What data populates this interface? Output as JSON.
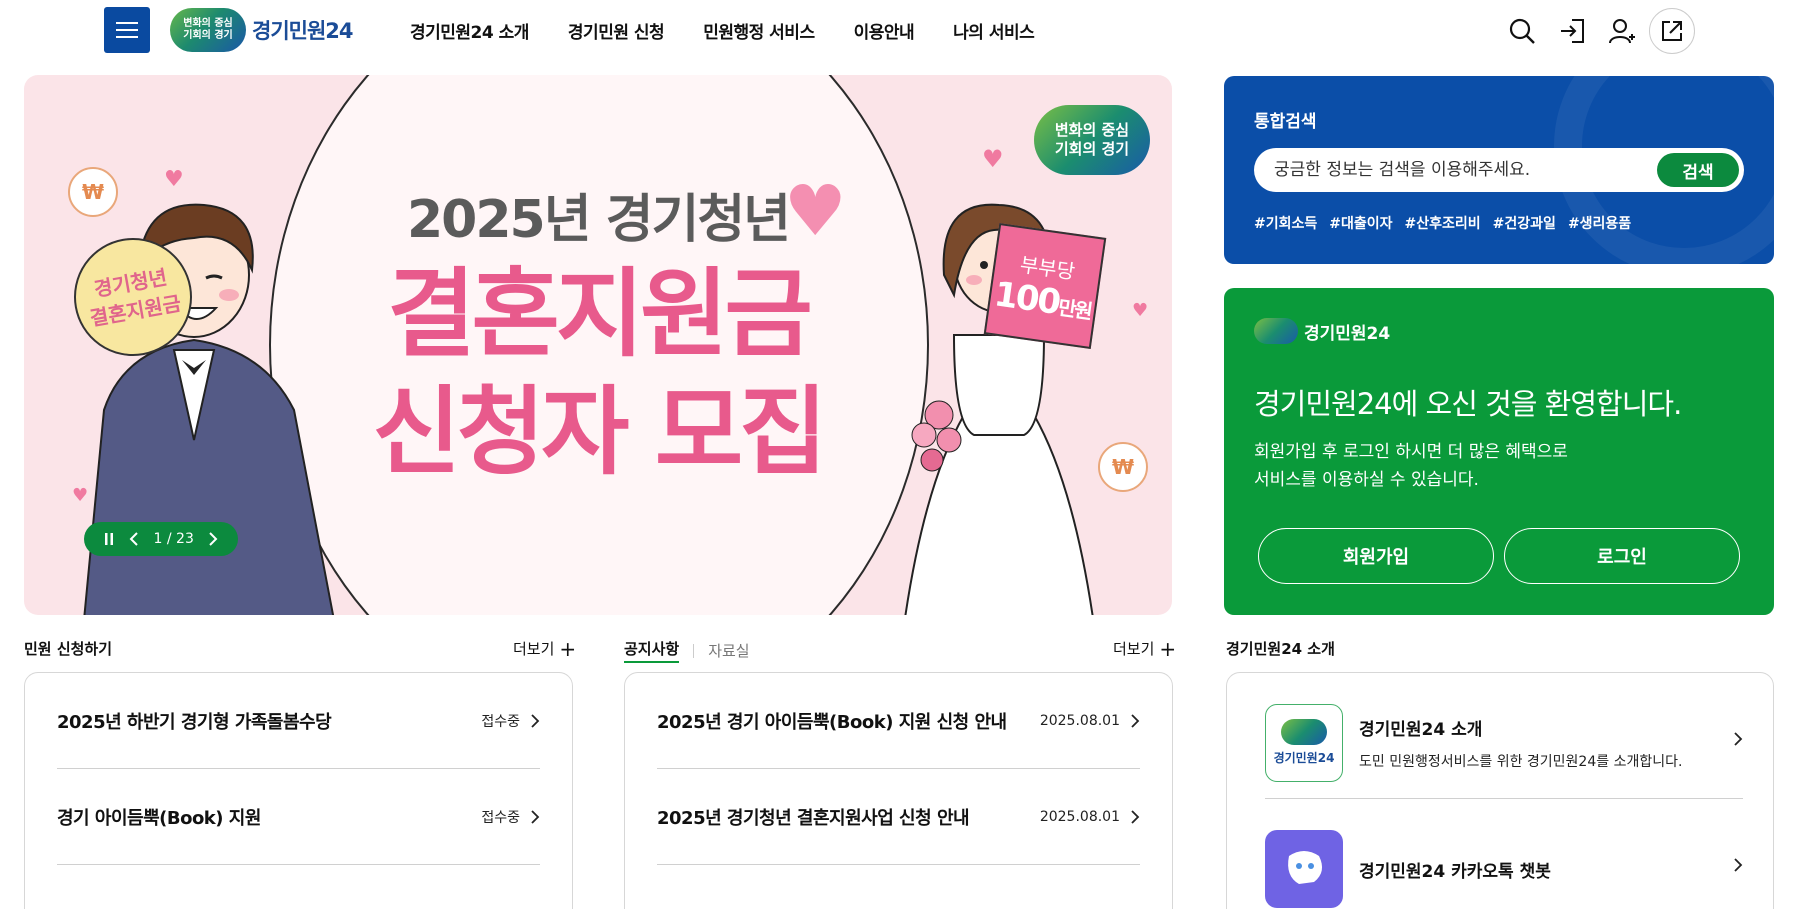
{
  "header": {
    "logo_badge_line1": "변화의 중심",
    "logo_badge_line2": "기회의 경기",
    "logo_text": "경기민원24",
    "nav": [
      "경기민원24 소개",
      "경기민원 신청",
      "민원행정 서비스",
      "이용안내",
      "나의 서비스"
    ]
  },
  "hero": {
    "title_year": "2025년 경기청년",
    "title_main_line1": "결혼지원금",
    "title_main_line2": "신청자 모집",
    "badge_line1": "변화의 중심",
    "badge_line2": "기회의 경기",
    "left_sign_line1": "경기청년",
    "left_sign_line2": "결혼지원금",
    "right_sign_line1": "부부당",
    "right_sign_amount": "100",
    "right_sign_unit": "만원",
    "coin_symbol": "₩",
    "slide_counter": "1 / 23",
    "accent_color": "#e85a8c"
  },
  "search": {
    "label": "통합검색",
    "placeholder": "궁금한 정보는 검색을 이용해주세요.",
    "button": "검색",
    "tags": [
      "#기회소득",
      "#대출이자",
      "#산후조리비",
      "#건강과일",
      "#생리용품"
    ]
  },
  "welcome": {
    "brand": "경기민원24",
    "heading": "경기민원24에 오신 것을 환영합니다.",
    "desc_line1": "회원가입 후 로그인 하시면 더 많은 혜택으로",
    "desc_line2": "서비스를 이용하실 수 있습니다.",
    "join": "회원가입",
    "login": "로그인"
  },
  "apply": {
    "title": "민원 신청하기",
    "more": "더보기",
    "items": [
      {
        "title": "2025년 하반기 경기형 가족돌봄수당",
        "status": "접수중"
      },
      {
        "title": "경기 아이듬뿍(Book) 지원",
        "status": "접수중"
      }
    ]
  },
  "notice": {
    "tab_active": "공지사항",
    "tab_inactive": "자료실",
    "more": "더보기",
    "items": [
      {
        "title": "2025년 경기 아이듬뿍(Book) 지원 신청 안내",
        "date": "2025.08.01"
      },
      {
        "title": "2025년 경기청년 결혼지원사업 신청 안내",
        "date": "2025.08.01"
      }
    ]
  },
  "intro": {
    "title": "경기민원24 소개",
    "items": [
      {
        "title": "경기민원24 소개",
        "desc": "도민 민원행정서비스를 위한 경기민원24를 소개합니다.",
        "thumb_label": "경기민원24"
      },
      {
        "title": "경기민원24 카카오톡 챗봇",
        "desc": ""
      }
    ]
  },
  "colors": {
    "primary_blue": "#0b4ea8",
    "primary_green": "#0a9a3a",
    "hero_bg": "#fbe4e8"
  }
}
